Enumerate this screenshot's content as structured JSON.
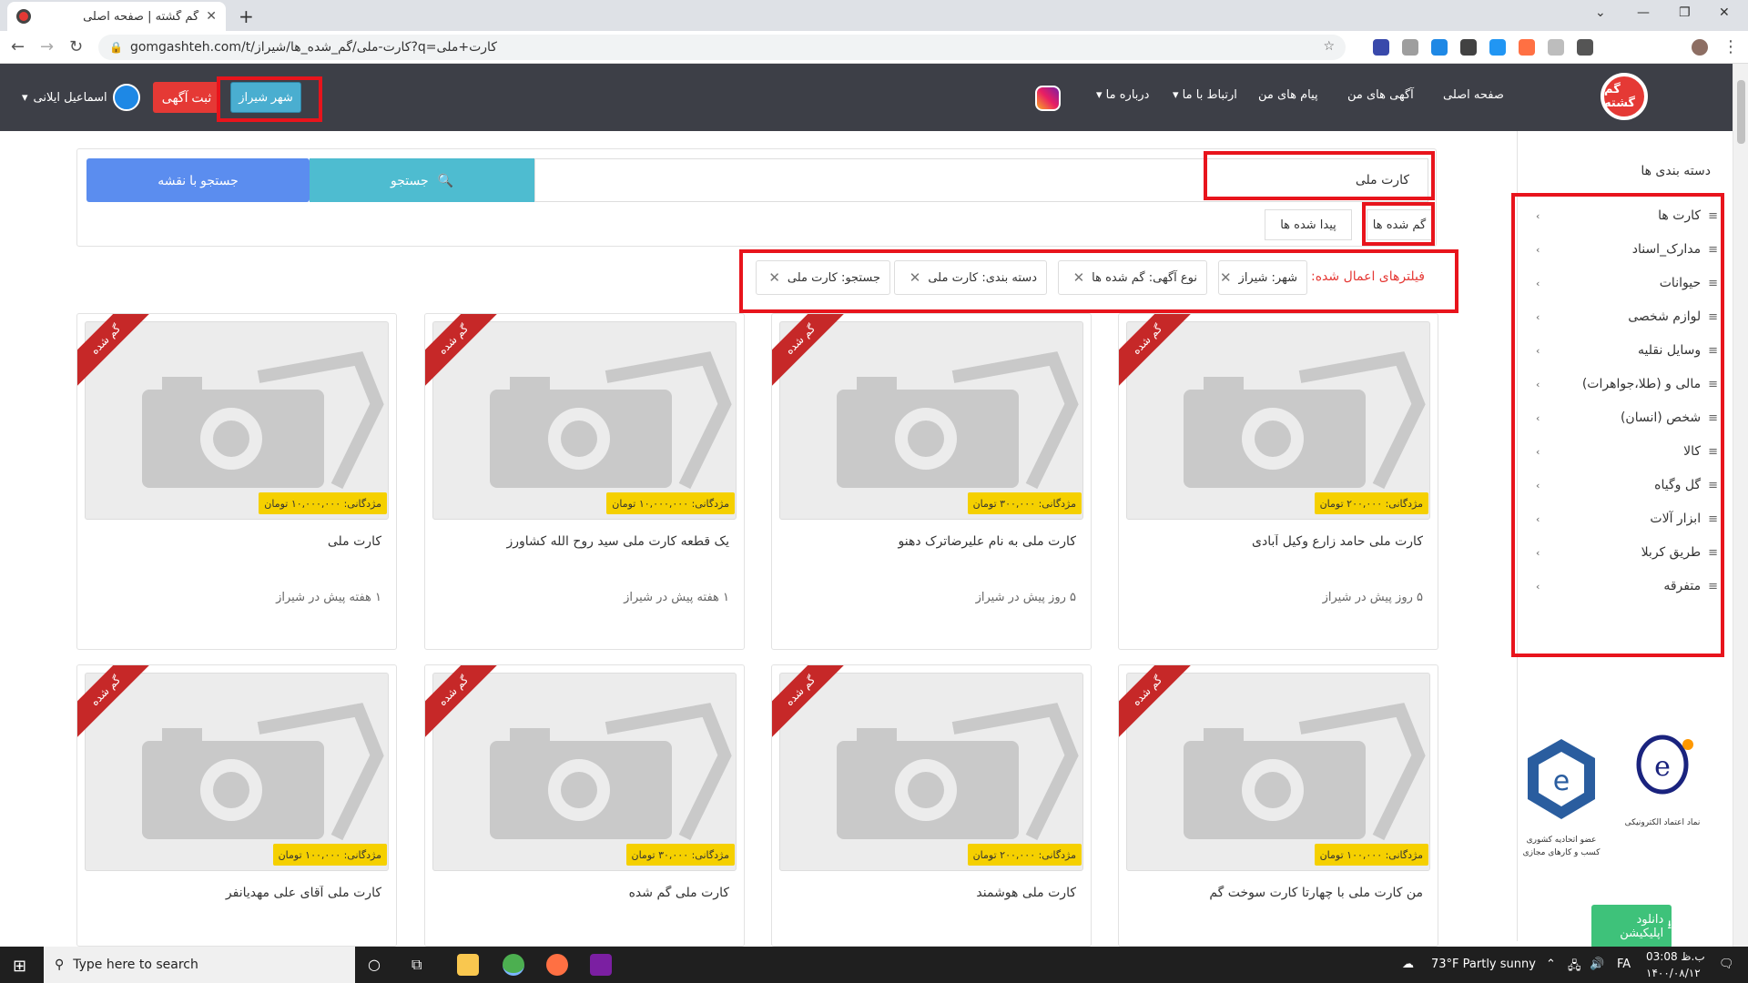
{
  "browser": {
    "tab_title": "گم گشته | صفحه اصلی",
    "url": "gomgashteh.com/t/کارت-ملی/گم_شده_ها/شیراز?q=کارت+ملی"
  },
  "header": {
    "logo_text": "گم گشته",
    "nav": [
      "صفحه اصلی",
      "آگهی های من",
      "پیام های من",
      "ارتباط با ما",
      "درباره ما"
    ],
    "post_ad": "ثبت آگهی",
    "city": "شهر شیراز",
    "user": "اسماعیل ایلانی"
  },
  "search": {
    "query": "کارت ملی",
    "search_button": "جستجو",
    "map_button": "جستجو با نقشه",
    "tabs": [
      "گم شده ها",
      "پیدا شده ها"
    ]
  },
  "filters": {
    "label": "فیلترهای اعمال شده:",
    "chips": [
      "شهر: شیراز",
      "نوع آگهی: گم شده ها",
      "دسته بندی: کارت ملی",
      "جستجو: کارت ملی"
    ]
  },
  "cards": [
    {
      "ribbon": "گم شده",
      "reward": "مژدگانی: ۲۰۰,۰۰۰ تومان",
      "title": "کارت ملی حامد زارع وکیل آبادی",
      "meta": "۵ روز پیش در شیراز"
    },
    {
      "ribbon": "گم شده",
      "reward": "مژدگانی: ۳۰۰,۰۰۰ تومان",
      "title": "کارت ملی به نام علیرضاترک دهنو",
      "meta": "۵ روز پیش در شیراز"
    },
    {
      "ribbon": "گم شده",
      "reward": "مژدگانی: ۱۰,۰۰۰,۰۰۰ تومان",
      "title": "یک قطعه کارت ملی سید روح الله کشاورز",
      "meta": "۱ هفته پیش در شیراز"
    },
    {
      "ribbon": "گم شده",
      "reward": "مژدگانی: ۱۰,۰۰۰,۰۰۰ تومان",
      "title": "کارت ملی",
      "meta": "۱ هفته پیش در شیراز"
    },
    {
      "ribbon": "گم شده",
      "reward": "مژدگانی: ۱۰۰,۰۰۰ تومان",
      "title": "من کارت ملی با چهارتا کارت سوخت گم",
      "meta": ""
    },
    {
      "ribbon": "گم شده",
      "reward": "مژدگانی: ۲۰۰,۰۰۰ تومان",
      "title": "کارت ملی هوشمند",
      "meta": ""
    },
    {
      "ribbon": "گم شده",
      "reward": "مژدگانی: ۳۰,۰۰۰ تومان",
      "title": "کارت ملی گم شده",
      "meta": ""
    },
    {
      "ribbon": "گم شده",
      "reward": "مژدگانی: ۱۰۰,۰۰۰ تومان",
      "title": "کارت ملی آقای علی مهدیانفر",
      "meta": ""
    }
  ],
  "sidebar": {
    "title": "دسته بندی ها",
    "items": [
      "کارت ها",
      "مدارک_اسناد",
      "حیوانات",
      "لوازم شخصی",
      "وسایل نقلیه",
      "مالی و (طلا،جواهرات)",
      "شخص (انسان)",
      "کالا",
      "گل وگیاه",
      "ابزار آلات",
      "طریق کربلا",
      "متفرقه"
    ],
    "badge_union_text": "عضو اتحادیه کشوری کسب و کارهای مجازی",
    "badge_enamad_text": "نماد اعتماد الکترونیکی",
    "download": "دانلود اپلیکیشن"
  },
  "taskbar": {
    "search_placeholder": "Type here to search",
    "weather": "73°F  Partly sunny",
    "lang": "FA",
    "time": "03:08 ب.ظ",
    "date": "۱۴۰۰/۰۸/۱۲"
  },
  "colors": {
    "header_bg": "#3d3f47",
    "accent_red": "#e53935",
    "search_btn": "#4ebcd0",
    "map_btn": "#5b8def",
    "reward_yellow": "#f5d000",
    "annotation_red": "#e8141c"
  }
}
